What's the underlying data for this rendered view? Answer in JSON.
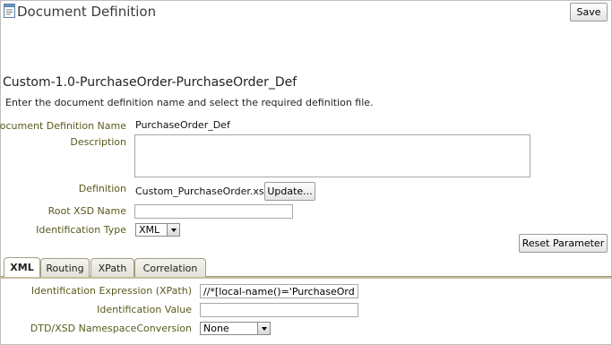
{
  "header": {
    "title": "Document Definition",
    "save_label": "Save"
  },
  "definition": {
    "heading": "Custom-1.0-PurchaseOrder-PurchaseOrder_Def",
    "instruction": "Enter the document definition name and select the required definition file."
  },
  "form": {
    "name_label": "Document Definition Name",
    "name_value": "PurchaseOrder_Def",
    "description_label": "Description",
    "description_value": "",
    "definition_label": "Definition",
    "definition_value": "Custom_PurchaseOrder.xsd",
    "update_label": "Update...",
    "root_xsd_label": "Root XSD Name",
    "root_xsd_value": "",
    "identification_type_label": "Identification Type",
    "identification_type_value": "XML",
    "reset_label": "Reset Parameter"
  },
  "tabs": [
    {
      "label": "XML",
      "active": true
    },
    {
      "label": "Routing",
      "active": false
    },
    {
      "label": "XPath",
      "active": false
    },
    {
      "label": "Correlation",
      "active": false
    }
  ],
  "xml_tab": {
    "expression_label": "Identification Expression (XPath)",
    "expression_value": "//*[local-name()='PurchaseOrder']",
    "identification_value_label": "Identification Value",
    "identification_value": "",
    "namespace_label": "DTD/XSD NamespaceConversion",
    "namespace_value": "None"
  }
}
